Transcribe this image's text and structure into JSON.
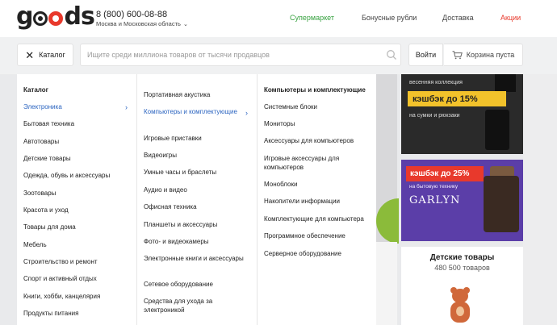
{
  "header": {
    "logo_text": "goods",
    "phone": "8 (800) 600-08-88",
    "region": "Москва и Московская область",
    "nav": {
      "supermarket": "Супермаркет",
      "bonus": "Бонусные рубли",
      "delivery": "Доставка",
      "promo": "Акции"
    },
    "colors": {
      "green": "#36a13f",
      "red": "#e8392c",
      "link_blue": "#2b64c0"
    }
  },
  "search": {
    "catalog_label": "Каталог",
    "placeholder": "Ищите среди миллиона товаров от тысячи продавцов",
    "login_label": "Войти",
    "cart_label": "Корзина пуста"
  },
  "menu": {
    "title": "Каталог",
    "categories": [
      "Электроника",
      "Бытовая техника",
      "Автотовары",
      "Детские товары",
      "Одежда, обувь и аксессуары",
      "Зоотовары",
      "Красота и уход",
      "Товары для дома",
      "Мебель",
      "Строительство и ремонт",
      "Спорт и активный отдых",
      "Книги, хобби, канцелярия",
      "Продукты питания"
    ],
    "subcategories": [
      "Портативная акустика",
      "Компьютеры и комплектующие",
      "Игровые приставки",
      "Видеоигры",
      "Умные часы и браслеты",
      "Аудио и видео",
      "Офисная техника",
      "Планшеты и аксессуары",
      "Фото- и видеокамеры",
      "Электронные книги и аксессуары",
      "Сетевое оборудование",
      "Средства для ухода за электроникой"
    ],
    "detail_title": "Компьютеры и комплектующие",
    "detail_items": [
      "Системные блоки",
      "Мониторы",
      "Аксессуары для компьютеров",
      "Игровые аксессуары для компьютеров",
      "Моноблоки",
      "Накопители информации",
      "Комплектующие для компьютера",
      "Программное обеспечение",
      "Серверное оборудование"
    ]
  },
  "banners": {
    "b1_top": "весенняя коллекция",
    "b1_badge": "кэшбэк до 15%",
    "b1_sub": "на сумки и рюкзаки",
    "b2_badge": "кэшбэк до 25%",
    "b2_sub": "на бытовую технику",
    "b2_brand": "GARLYN",
    "b3_title": "Детские товары",
    "b3_count": "480 500 товаров"
  }
}
